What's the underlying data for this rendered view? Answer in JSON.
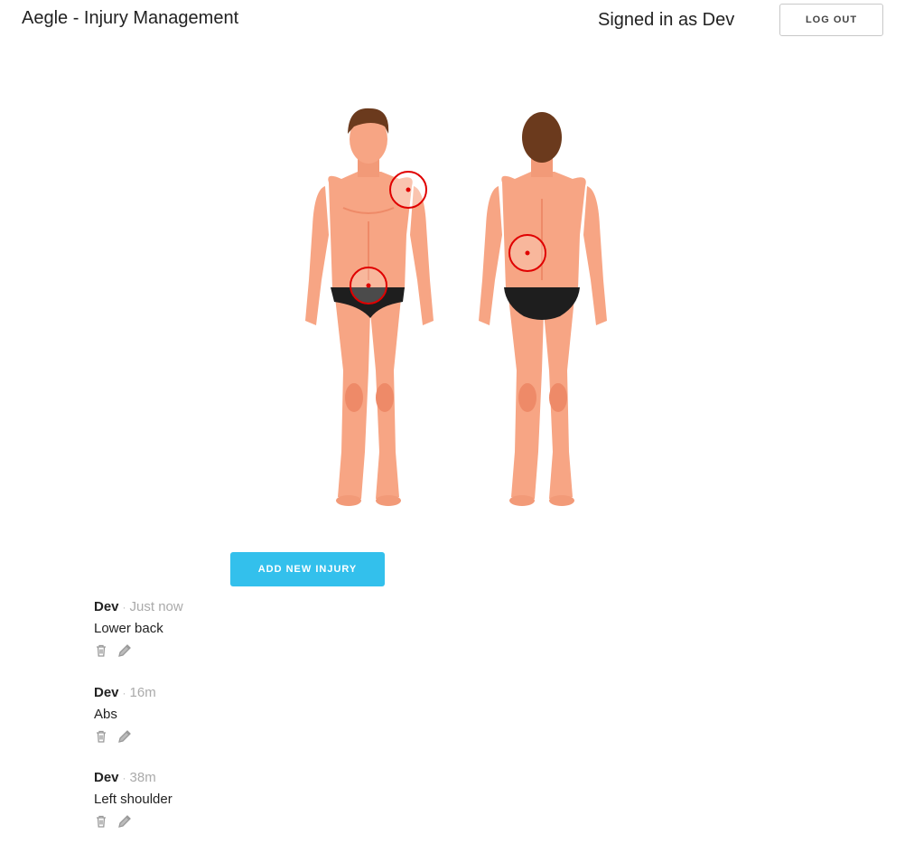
{
  "header": {
    "app_title": "Aegle - Injury Management",
    "signed_in_text": "Signed in as Dev",
    "logout_label": "LOG OUT"
  },
  "body_map": {
    "views": [
      "front",
      "back"
    ],
    "markers": [
      {
        "view": "front",
        "region": "left shoulder"
      },
      {
        "view": "front",
        "region": "abs"
      },
      {
        "view": "back",
        "region": "lower back"
      }
    ],
    "marker_color": "#e00000",
    "skin_color": "#f7a584",
    "underwear_color": "#1e1e1e",
    "hair_color": "#6b3a1d"
  },
  "actions": {
    "add_injury_label": "ADD NEW INJURY",
    "accent_color": "#33c0ec"
  },
  "injuries": [
    {
      "author": "Dev",
      "separator": "·",
      "time": "Just now",
      "description": "Lower back",
      "icons": [
        "trash-icon",
        "pencil-icon"
      ]
    },
    {
      "author": "Dev",
      "separator": "·",
      "time": "16m",
      "description": "Abs",
      "icons": [
        "trash-icon",
        "pencil-icon"
      ]
    },
    {
      "author": "Dev",
      "separator": "·",
      "time": "38m",
      "description": "Left shoulder",
      "icons": [
        "trash-icon",
        "pencil-icon"
      ]
    }
  ]
}
